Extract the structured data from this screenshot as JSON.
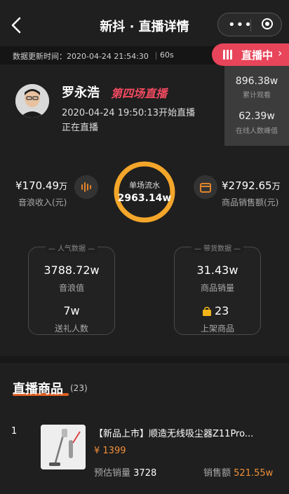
{
  "header": {
    "title": "新抖 · 直播详情",
    "back_icon": "chevron-left-icon",
    "more_icon": "more-dots-icon",
    "close_icon": "target-icon"
  },
  "update": {
    "label": "数据更新时间：2020-04-24 21:54:30",
    "interval": "60s"
  },
  "live": {
    "label": "直播中",
    "icon": "bars-icon"
  },
  "dropdown": {
    "total_views": "896.38w",
    "total_views_label": "累计观看",
    "peak_online": "62.39w",
    "peak_online_label": "在线人数峰值"
  },
  "anchor": {
    "name": "罗永浩",
    "tagline": "第四场直播",
    "start_time": "2020-04-24 19:50:13开始直播",
    "status": "正在直播"
  },
  "flow": {
    "label": "单场流水",
    "value": "2963.14w",
    "ring_color": "#f4a62a"
  },
  "left_stat": {
    "currency": "¥",
    "value": "170.49",
    "unit": "万",
    "label": "音浪收入(元)"
  },
  "right_stat": {
    "currency": "¥",
    "value": "2792.65",
    "unit": "万",
    "label": "商品销售额(元)"
  },
  "popularity": {
    "title": "人气数据",
    "sound_value": "3788.72w",
    "sound_label": "音浪值",
    "gifters_value": "7w",
    "gifters_label": "送礼人数"
  },
  "goods": {
    "title": "带货数据",
    "sales_value": "31.43w",
    "sales_label": "商品销量",
    "listed_value": "23",
    "listed_label": "上架商品"
  },
  "section": {
    "title": "直播商品",
    "count": "(23)"
  },
  "products": [
    {
      "index": "1",
      "title": "【新品上市】顺造无线吸尘器Z11Pro...",
      "price": "¥ 1399",
      "est_label": "预估销量",
      "est_value": "3728",
      "sales_label": "销售额",
      "sales_value": "521.55w"
    }
  ],
  "colors": {
    "accent_red": "#e8455a",
    "accent_orange": "#f0903a",
    "ring": "#f4a62a"
  }
}
